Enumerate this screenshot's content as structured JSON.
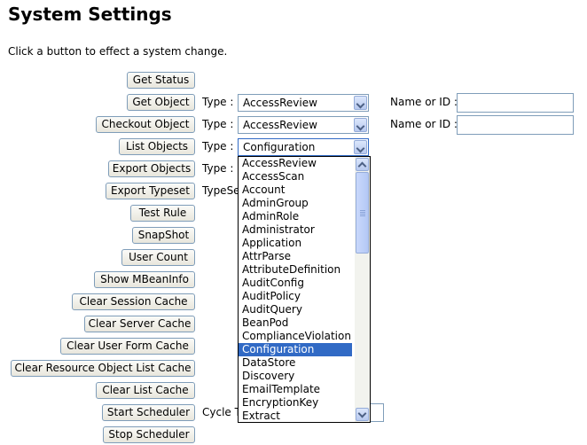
{
  "page": {
    "title": "System Settings",
    "instruction": "Click a button to effect a system change."
  },
  "buttons": {
    "get_status": "Get Status",
    "get_object": "Get Object",
    "checkout_object": "Checkout Object",
    "list_objects": "List Objects",
    "export_objects": "Export Objects",
    "export_typeset": "Export Typeset",
    "test_rule": "Test Rule",
    "snapshot": "SnapShot",
    "user_count": "User Count",
    "show_mbeaninfo": "Show MBeanInfo",
    "clear_session_cache": "Clear Session Cache",
    "clear_server_cache": "Clear Server Cache",
    "clear_user_form_cache": "Clear User Form Cache",
    "clear_resource_object_list_cache": "Clear Resource Object List Cache",
    "clear_list_cache": "Clear List Cache",
    "start_scheduler": "Start Scheduler",
    "stop_scheduler": "Stop Scheduler"
  },
  "labels": {
    "type": "Type :",
    "name_or_id": "Name or ID :",
    "typeset_partial": "TypeSe",
    "cycle_partial": "Cycle T"
  },
  "selects": {
    "get_object_type": "AccessReview",
    "checkout_object_type": "AccessReview",
    "list_objects_type": "Configuration"
  },
  "inputs": {
    "get_object_name": "",
    "checkout_object_name": ""
  },
  "dropdown_options": [
    "AccessReview",
    "AccessScan",
    "Account",
    "AdminGroup",
    "AdminRole",
    "Administrator",
    "Application",
    "AttrParse",
    "AttributeDefinition",
    "AuditConfig",
    "AuditPolicy",
    "AuditQuery",
    "BeanPod",
    "ComplianceViolation",
    "Configuration",
    "DataStore",
    "Discovery",
    "EmailTemplate",
    "EncryptionKey",
    "Extract"
  ],
  "dropdown_selected": "Configuration",
  "icons": {
    "select_arrow": "chevron-down-icon",
    "scroll_up": "chevron-up-icon",
    "scroll_down": "chevron-down-icon"
  },
  "colors": {
    "selection": "#316ac5",
    "control_border": "#7f9db9"
  }
}
